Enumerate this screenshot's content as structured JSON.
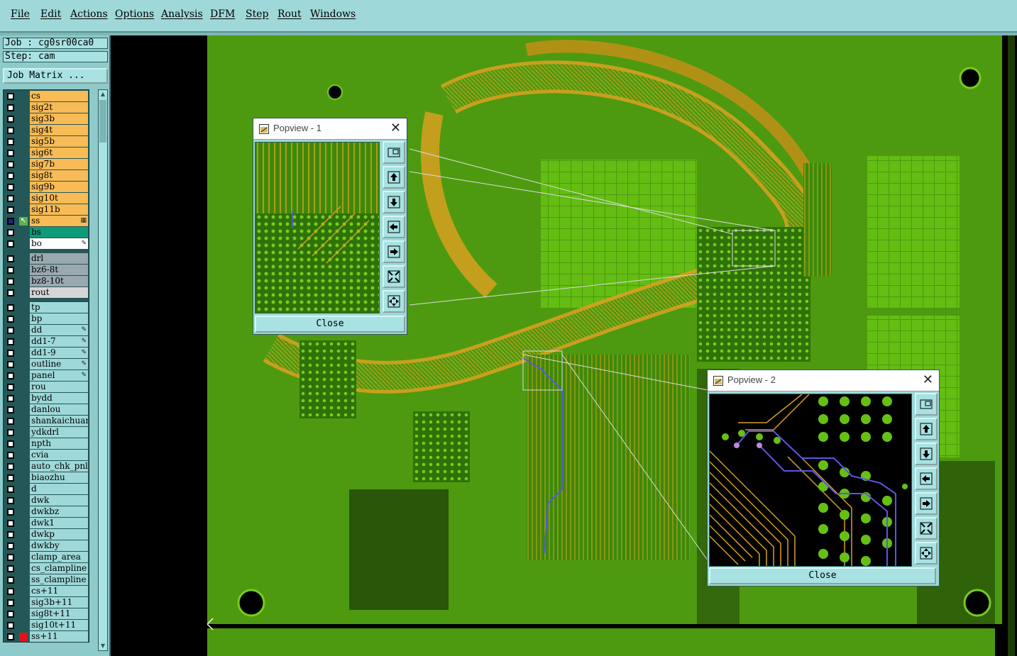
{
  "menu": [
    "File",
    "Edit",
    "Actions",
    "Options",
    "Analysis",
    "DFM",
    "Step",
    "Rout",
    "Windows"
  ],
  "info": {
    "job": "Job : cg0sr00ca0",
    "step": "Step: cam"
  },
  "job_matrix_label": "Job Matrix ...",
  "layer_groups": [
    {
      "color": "#f9bb55",
      "layers": [
        "cs",
        "sig2t",
        "sig3b",
        "sig4t",
        "sig5b",
        "sig6t",
        "sig7b",
        "sig8t",
        "sig9b",
        "sig10t",
        "sig11b"
      ]
    },
    {
      "color": "#f9bb55",
      "layers": [
        "ss"
      ]
    },
    {
      "color": "#0f9a7a",
      "layers": [
        "bs"
      ]
    },
    {
      "color": "#ffffff",
      "layers": [
        "bo"
      ]
    },
    {
      "color": "#9aa8b0",
      "layers": [
        "drl",
        "bz6-8t",
        "bz8-10t"
      ]
    },
    {
      "color": "#d6d6d6",
      "layers": [
        "rout"
      ]
    },
    {
      "color": "#9ed8d8",
      "layers": [
        "tp",
        "bp",
        "dd",
        "dd1-7",
        "dd1-9",
        "outline",
        "panel",
        "rou",
        "bydd",
        "danlou",
        "shankaichuan",
        "ydkdrl",
        "npth",
        "cvia",
        "auto_chk_pnl",
        "biaozhu",
        "d",
        "dwk",
        "dwkbz",
        "dwk1",
        "dwkp",
        "dwkby",
        "clamp_area",
        "cs_clampline",
        "ss_clampline",
        "cs+11",
        "sig3b+11",
        "sig8t+11",
        "sig10t+11",
        "ss+11"
      ]
    }
  ],
  "layer_icons": {
    "ss": "grid-icon",
    "bo": "brush-icon",
    "dd": "brush-icon",
    "dd1-7": "brush-icon",
    "dd1-9": "brush-icon",
    "outline": "brush-icon",
    "panel": "brush-icon"
  },
  "active_layer": "ss",
  "red_mark_layer": "ss+11",
  "popview1": {
    "title": "Popview - 1",
    "close_label": "Close"
  },
  "popview2": {
    "title": "Popview - 2",
    "close_label": "Close"
  },
  "colors": {
    "board": "#4d9a10",
    "trace": "#d8a020",
    "copper": "#66c014",
    "ui": "#9ed8d8",
    "selected_trace": "#5a56e6"
  }
}
